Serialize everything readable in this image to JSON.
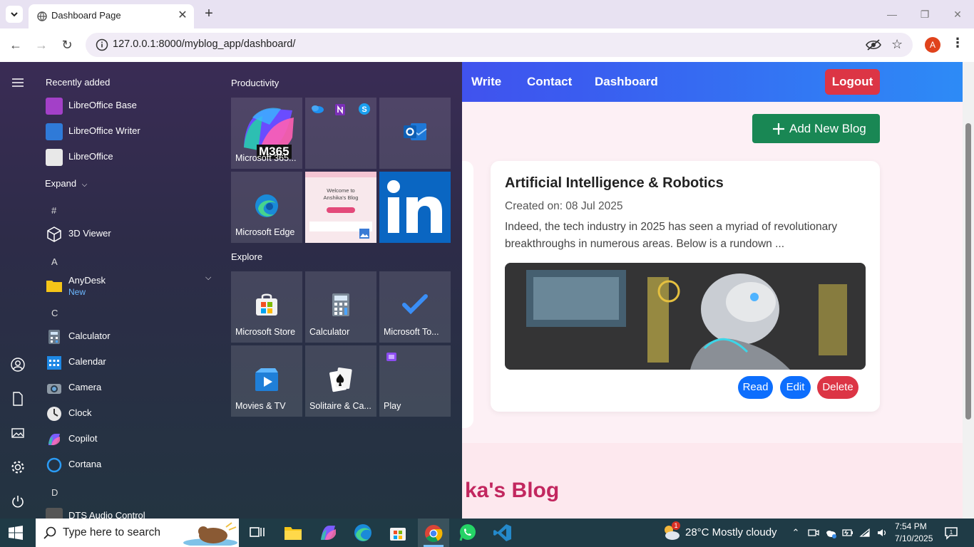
{
  "browser": {
    "tab_title": "Dashboard Page",
    "new_tab": "+",
    "url": "127.0.0.1:8000/myblog_app/dashboard/",
    "profile_initial": "A"
  },
  "site": {
    "nav_links": [
      "Write",
      "Contact",
      "Dashboard"
    ],
    "logout": "Logout",
    "add_blog": "Add New Blog",
    "footer_title": "ka's Blog",
    "card": {
      "title": "Artificial Intelligence & Robotics",
      "date": "Created on: 08 Jul 2025",
      "excerpt": "Indeed, the tech industry in 2025 has seen a myriad of revolutionary breakthroughs in numerous areas. Below is a rundown ...",
      "buttons": {
        "read": "Read",
        "edit": "Edit",
        "delete": "Delete"
      }
    },
    "colors": {
      "logout": "#dc3545",
      "add_blog": "#198754",
      "read": "#0d6efd",
      "delete": "#dc3545",
      "footer_title": "#c2275f"
    }
  },
  "start_menu": {
    "recently_added_title": "Recently added",
    "recent": [
      "LibreOffice Base",
      "LibreOffice Writer",
      "LibreOffice"
    ],
    "expand": "Expand",
    "letters": {
      "hash": "#",
      "a": "A",
      "c": "C",
      "d": "D"
    },
    "apps": {
      "viewer": "3D Viewer",
      "anydesk": "AnyDesk",
      "anydesk_badge": "New",
      "calculator": "Calculator",
      "calendar": "Calendar",
      "camera": "Camera",
      "clock": "Clock",
      "copilot": "Copilot",
      "cortana": "Cortana",
      "dts": "DTS Audio Control"
    },
    "productivity_title": "Productivity",
    "explore_title": "Explore",
    "tiles": {
      "m365": "Microsoft 365...",
      "m365_badge": "M365",
      "edge": "Microsoft Edge",
      "store": "Microsoft Store",
      "calculator": "Calculator",
      "todo": "Microsoft To...",
      "movies": "Movies & TV",
      "solitaire": "Solitaire & Ca...",
      "play": "Play",
      "blog_preview_line1": "Welcome to",
      "blog_preview_line2": "Anshika's Blog"
    }
  },
  "taskbar": {
    "search_placeholder": "Type here to search",
    "weather": "28°C  Mostly cloudy",
    "weather_badge": "1",
    "time": "7:54 PM",
    "date": "7/10/2025"
  }
}
